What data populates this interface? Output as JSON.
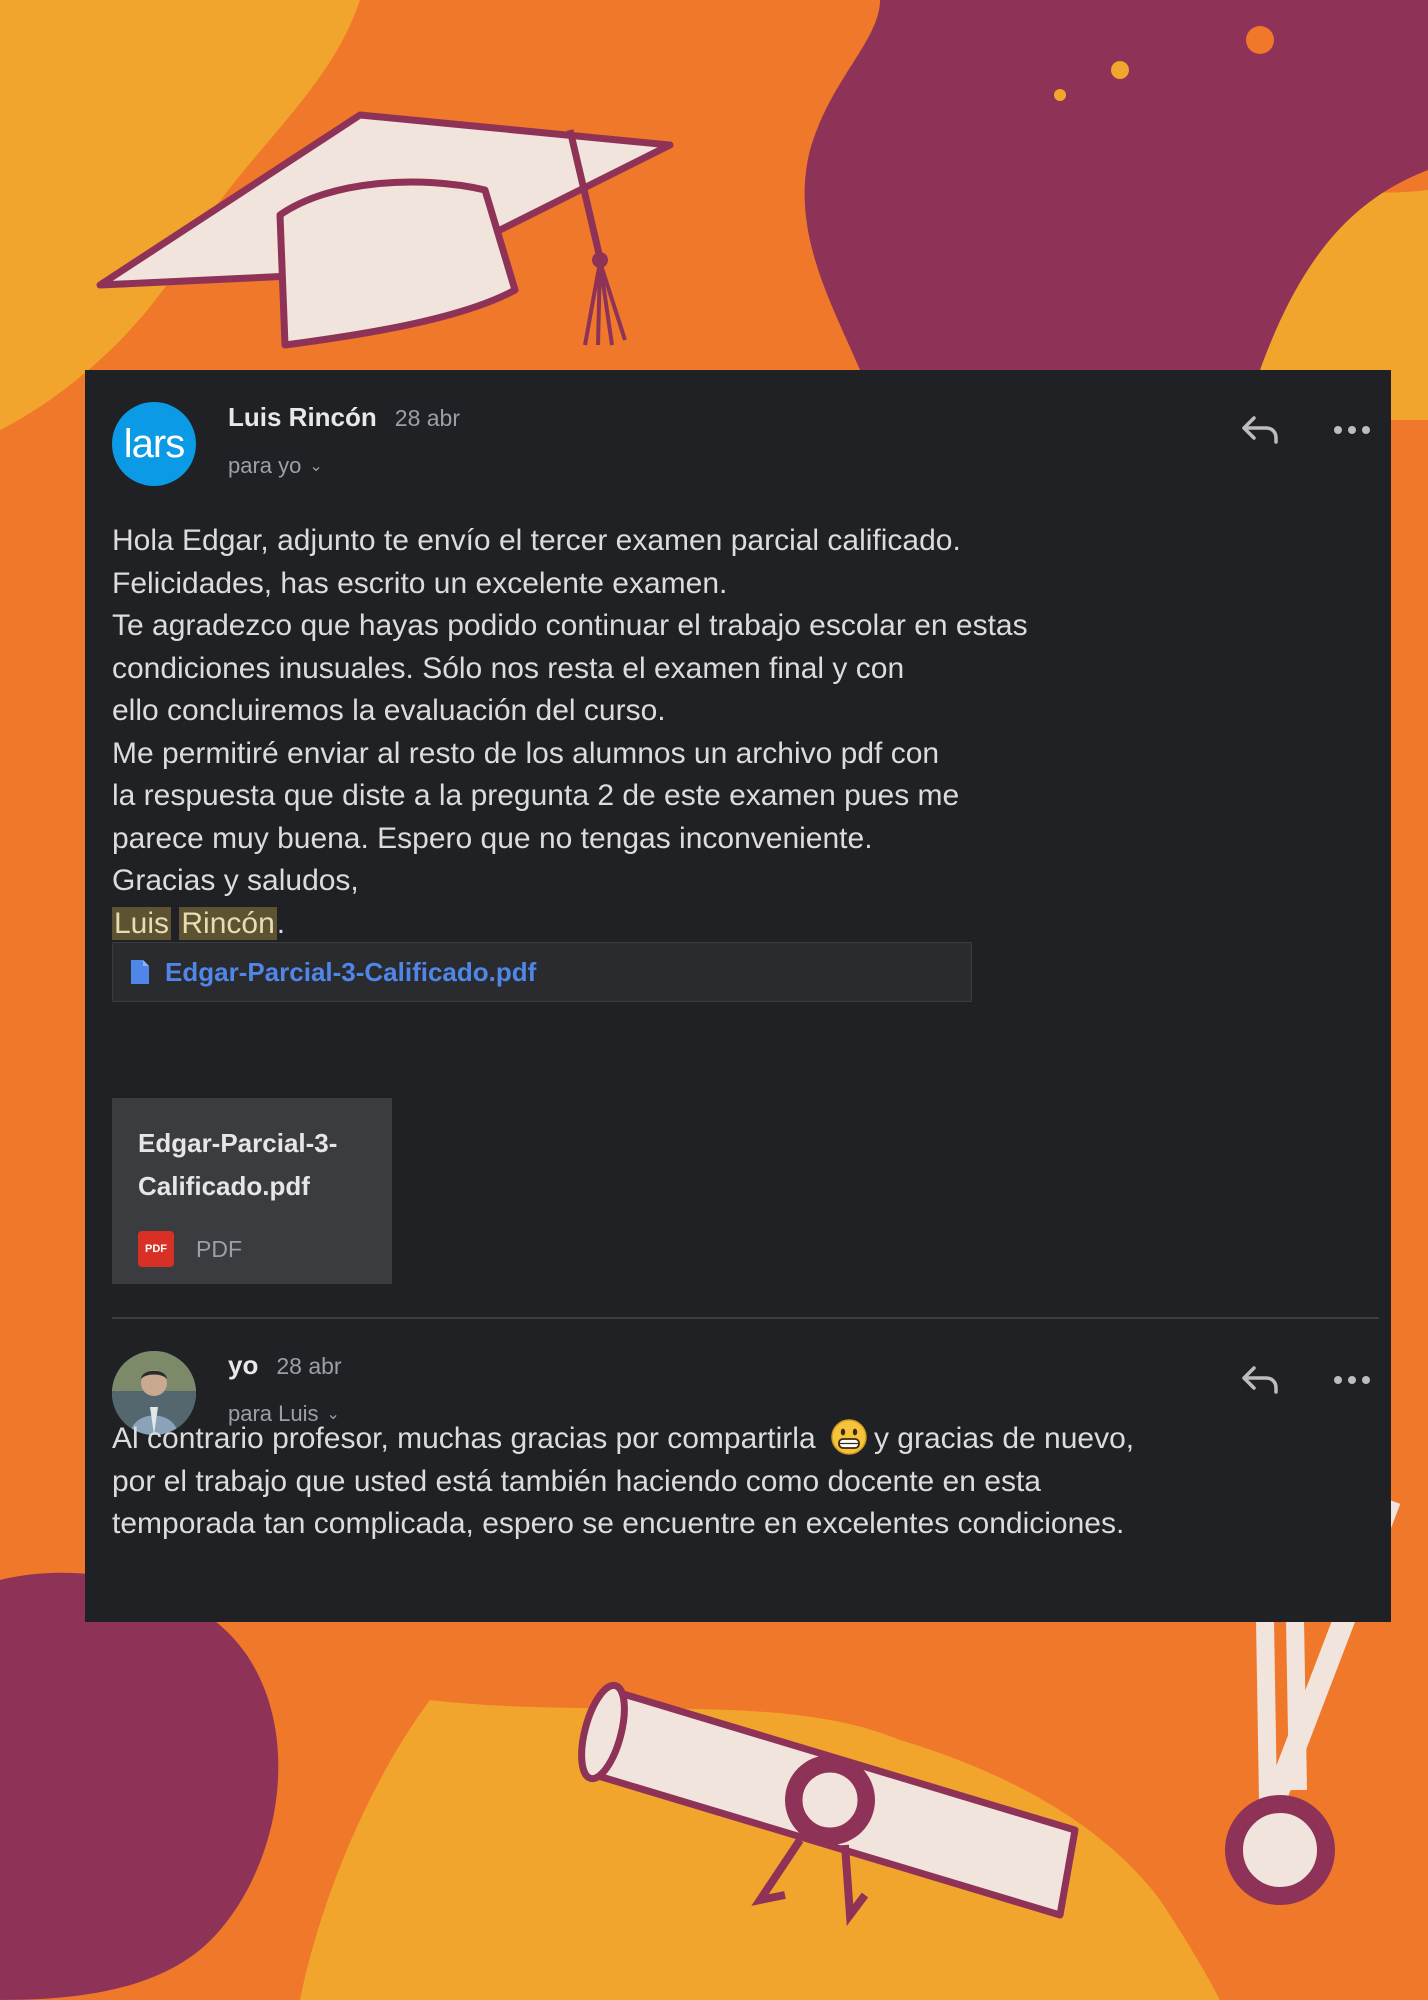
{
  "colors": {
    "background_orange": "#f0782a",
    "background_yellow": "#f2a52c",
    "background_plum": "#8e3357",
    "panel": "#202124",
    "link_blue": "#4f86e8",
    "avatar_blue": "#0b9be6"
  },
  "messages": [
    {
      "avatar_text": "lars",
      "sender": "Luis Rincón",
      "date": "28 abr",
      "recipient": "para yo",
      "body_lines": [
        "Hola Edgar, adjunto te envío el tercer examen parcial calificado.",
        "Felicidades, has escrito un excelente examen.",
        "Te agradezco que hayas podido continuar el trabajo escolar en estas",
        "condiciones inusuales. Sólo nos resta el examen final y con",
        "ello concluiremos la evaluación del curso.",
        "Me permitiré enviar al resto de los alumnos un archivo pdf con",
        "la respuesta que diste a la pregunta 2 de este examen pues me",
        "parece muy buena. Espero que no tengas inconveniente.",
        "Gracias y saludos,"
      ],
      "signature_first": "Luis",
      "signature_last": "Rincón",
      "signature_end": ".",
      "attachment_link": "Edgar-Parcial-3-Calificado.pdf",
      "attachment_card": {
        "name_line1": "Edgar-Parcial-3-",
        "name_line2": "Calificado.pdf",
        "badge": "PDF",
        "type": "PDF"
      }
    },
    {
      "sender": "yo",
      "date": "28 abr",
      "recipient": "para Luis",
      "body_line1_before": "Al contrario profesor, muchas gracias por compartirla",
      "body_line1_after": "y gracias de nuevo,",
      "body_lines": [
        "por el trabajo que usted está también haciendo como docente en esta",
        "temporada tan complicada, espero se encuentre en excelentes condiciones."
      ]
    }
  ],
  "icons": {
    "reply": "reply-icon",
    "more": "more-options-icon",
    "chevron": "chevron-down-icon",
    "file": "file-icon",
    "emoji": "grinning-face-emoji"
  }
}
